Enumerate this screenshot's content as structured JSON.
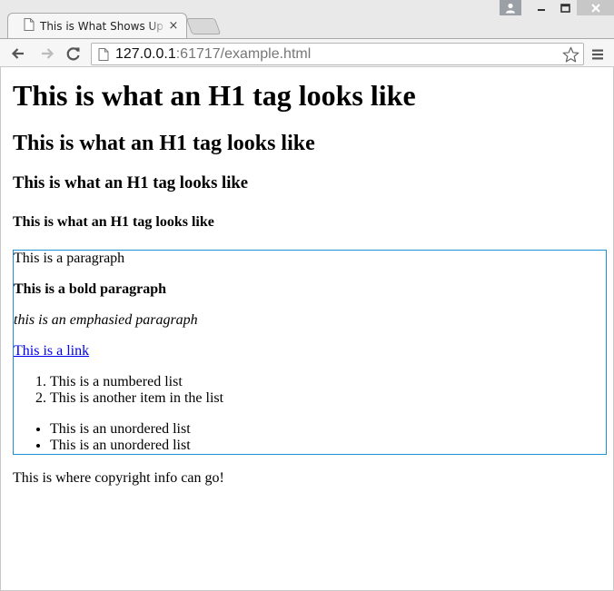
{
  "browser": {
    "tab_title": "This is What Shows Up On the Tab",
    "tab_close_glyph": "×",
    "url_host": "127.0.0.1",
    "url_rest": ":61717/example.html"
  },
  "page": {
    "h1": "This is what an H1 tag looks like",
    "h2": "This is what an H1 tag looks like",
    "h3": "This is what an H1 tag looks like",
    "h4": "This is what an H1 tag looks like",
    "paragraph": "This is a paragraph",
    "bold_paragraph": "This is a bold paragraph",
    "emphasized_paragraph": "this is an emphasied paragraph",
    "link_text": "This is a link",
    "ordered_list": [
      "This is a numbered list",
      "This is another item in the list"
    ],
    "unordered_list": [
      "This is an unordered list",
      "This is an unordered list"
    ],
    "footer": "This is where copyright info can go!"
  },
  "colors": {
    "content_border": "#1e90d6",
    "link": "#0000ee"
  },
  "icons": [
    "page-icon",
    "user-icon",
    "minimize-icon",
    "maximize-icon",
    "close-icon",
    "back-arrow-icon",
    "forward-arrow-icon",
    "reload-icon",
    "star-icon",
    "menu-icon"
  ]
}
